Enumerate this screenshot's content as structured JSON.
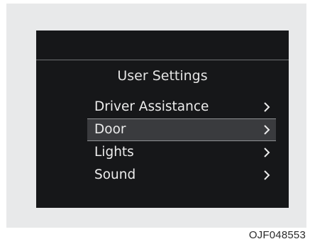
{
  "screen": {
    "title": "User Settings",
    "menu": [
      {
        "label": "Driver Assistance",
        "chevron": "chevron-right-icon",
        "selected": false
      },
      {
        "label": "Door",
        "chevron": "chevron-right-icon",
        "selected": true
      },
      {
        "label": "Lights",
        "chevron": "chevron-right-icon",
        "selected": false
      },
      {
        "label": "Sound",
        "chevron": "chevron-right-icon",
        "selected": false
      }
    ]
  },
  "figure_code": "OJF048553",
  "colors": {
    "frame": "#e8e9ea",
    "screen_bg": "#161719",
    "text": "#ececec",
    "selected_bg": "#3a3b3e"
  }
}
